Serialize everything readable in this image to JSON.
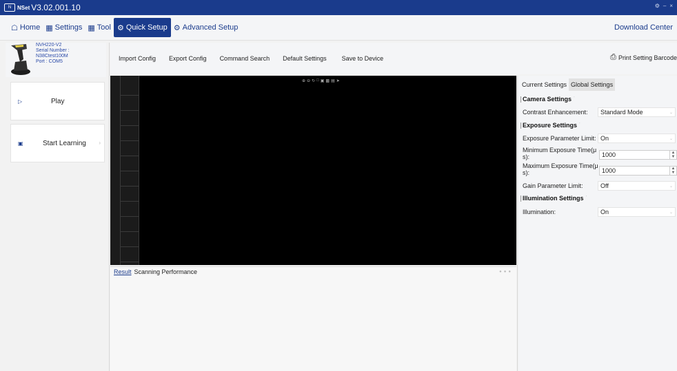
{
  "titlebar": {
    "logo_text": "N",
    "app_name": "NSet",
    "version": "V3.02.001.10",
    "controls": [
      "⚙",
      "–",
      "×"
    ]
  },
  "menu": {
    "home": "Home",
    "settings": "Settings",
    "tool": "Tool",
    "quick_setup": "Quick Setup",
    "advanced_setup": "Advanced Setup",
    "download_center": "Download Center"
  },
  "device": {
    "model": "NVH220-V2",
    "serial_label": "Serial Number :",
    "serial": "N38Ctest100M",
    "port": "Port : COM5"
  },
  "sidebar": {
    "play": "Play",
    "start_learning": "Start Learning"
  },
  "toolbar": {
    "import_config": "Import Config",
    "export_config": "Export Config",
    "command_search": "Command Search",
    "default_settings": "Default Settings",
    "save_to_device": "Save to Device",
    "print_setting_barcode": "Print Setting Barcode"
  },
  "result": {
    "tab_result": "Result",
    "tab_scanning": "Scanning Performance"
  },
  "settings": {
    "tab_current": "Current Settings",
    "tab_global": "Global Settings",
    "camera_title": "Camera Settings",
    "contrast_label": "Contrast Enhancement:",
    "contrast_value": "Standard Mode",
    "exposure_title": "Exposure Settings",
    "exposure_limit_label": "Exposure Parameter Limit:",
    "exposure_limit_value": "On",
    "min_exposure_label_1": "Minimum Exposure Time(μ",
    "min_exposure_label_2": "s):",
    "min_exposure_value": "1000",
    "max_exposure_label_1": "Maximum Exposure Time(μ",
    "max_exposure_label_2": "s):",
    "max_exposure_value": "1000",
    "gain_limit_label": "Gain Parameter Limit:",
    "gain_limit_value": "Off",
    "illumination_title": "Illumination Settings",
    "illumination_label": "Illumination:",
    "illumination_value": "On"
  },
  "colors": {
    "brand": "#1a3b8c",
    "viewer_bg": "#000000"
  }
}
